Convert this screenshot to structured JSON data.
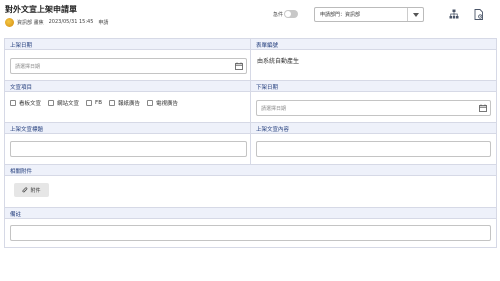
{
  "header": {
    "title": "對外文宣上架申請單",
    "author": "資訊部 畫焦",
    "datetime": "2023/05/31 15:45",
    "status": "申請",
    "urgent_label": "急件",
    "department": "申請部門：資訊部",
    "icons": [
      "org-chart-icon",
      "document-settings-icon"
    ]
  },
  "form": {
    "publish_date": {
      "label": "上架日期",
      "placeholder": "請選擇日期"
    },
    "form_number": {
      "label": "表單編號",
      "value": "由系統自動產生"
    },
    "content_items": {
      "label": "文宣項目",
      "options": [
        "看板文宣",
        "網站文宣",
        "FB",
        "報紙廣告",
        "電視廣告"
      ]
    },
    "unpublish_date": {
      "label": "下架日期",
      "placeholder": "請選擇日期"
    },
    "content_title": {
      "label": "上架文宣標題",
      "value": ""
    },
    "content_body": {
      "label": "上架文宣內容",
      "value": ""
    },
    "attachments": {
      "label": "相關附件",
      "button": "附件"
    },
    "remarks": {
      "label": "備註",
      "value": ""
    }
  },
  "colors": {
    "label_bg": "#eef1fa",
    "label_text": "#1f3a7a",
    "border": "#d6d9e6"
  }
}
